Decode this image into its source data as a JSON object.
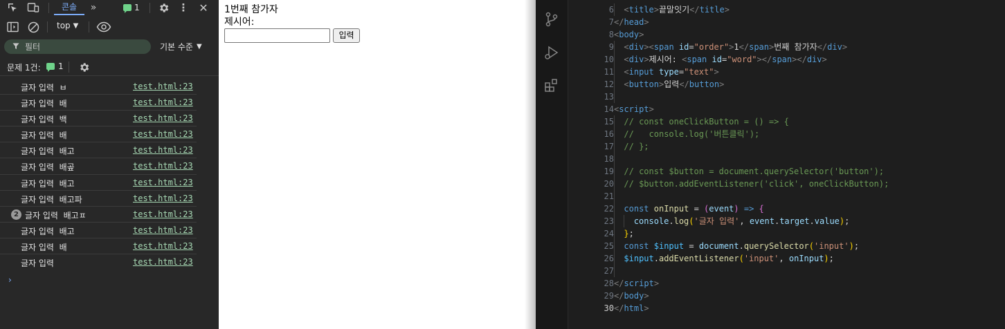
{
  "devtools": {
    "tab_console": "콘솔",
    "message_count": "1",
    "context": "top",
    "filter_placeholder": "필터",
    "levels": "기본 수준",
    "issues_label": "문제 1건:",
    "issues_count": "1",
    "logs": [
      {
        "text": "글자 입력  ㅂ",
        "source": "test.html:23"
      },
      {
        "text": "글자 입력  배",
        "source": "test.html:23"
      },
      {
        "text": "글자 입력  백",
        "source": "test.html:23"
      },
      {
        "text": "글자 입력  배",
        "source": "test.html:23"
      },
      {
        "text": "글자 입력  배고",
        "source": "test.html:23"
      },
      {
        "text": "글자 입력  배곺",
        "source": "test.html:23"
      },
      {
        "text": "글자 입력  배고",
        "source": "test.html:23"
      },
      {
        "text": "글자 입력  배고파",
        "source": "test.html:23"
      },
      {
        "text": "글자 입력  배고ㅍ",
        "source": "test.html:23",
        "count": "2"
      },
      {
        "text": "글자 입력  배고",
        "source": "test.html:23"
      },
      {
        "text": "글자 입력  배",
        "source": "test.html:23"
      },
      {
        "text": "글자 입력",
        "source": "test.html:23"
      }
    ],
    "prompt": "›"
  },
  "page": {
    "order_number": "1",
    "order_suffix": "번째 참가자",
    "word_label": "제시어:",
    "input_value": "",
    "button_label": "입력"
  },
  "editor": {
    "active_line": 30,
    "lines": [
      {
        "n": "6",
        "indent": 1,
        "html": "<span class=\"t\">&lt;</span><span class=\"tn\">title</span><span class=\"t\">&gt;</span><span class=\"tx\">끝말잇기</span><span class=\"t\">&lt;/</span><span class=\"tn\">title</span><span class=\"t\">&gt;</span>"
      },
      {
        "n": "7",
        "indent": 0,
        "html": "<span class=\"t\">&lt;/</span><span class=\"tn\">head</span><span class=\"t\">&gt;</span>"
      },
      {
        "n": "8",
        "indent": 0,
        "html": "<span class=\"t\">&lt;</span><span class=\"tn\">body</span><span class=\"t\">&gt;</span>"
      },
      {
        "n": "9",
        "indent": 1,
        "html": "<span class=\"t\">&lt;</span><span class=\"tn\">div</span><span class=\"t\">&gt;&lt;</span><span class=\"tn\">span</span> <span class=\"an\">id</span><span class=\"op\">=</span><span class=\"av\">\"order\"</span><span class=\"t\">&gt;</span><span class=\"tx\">1</span><span class=\"t\">&lt;/</span><span class=\"tn\">span</span><span class=\"t\">&gt;</span><span class=\"tx\">번째 참가자</span><span class=\"t\">&lt;/</span><span class=\"tn\">div</span><span class=\"t\">&gt;</span>"
      },
      {
        "n": "10",
        "indent": 1,
        "html": "<span class=\"t\">&lt;</span><span class=\"tn\">div</span><span class=\"t\">&gt;</span><span class=\"tx\">제시어: </span><span class=\"t\">&lt;</span><span class=\"tn\">span</span> <span class=\"an\">id</span><span class=\"op\">=</span><span class=\"av\">\"word\"</span><span class=\"t\">&gt;&lt;/</span><span class=\"tn\">span</span><span class=\"t\">&gt;&lt;/</span><span class=\"tn\">div</span><span class=\"t\">&gt;</span>"
      },
      {
        "n": "11",
        "indent": 1,
        "html": "<span class=\"t\">&lt;</span><span class=\"tn\">input</span> <span class=\"an\">type</span><span class=\"op\">=</span><span class=\"av\">\"text\"</span><span class=\"t\">&gt;</span>"
      },
      {
        "n": "12",
        "indent": 1,
        "html": "<span class=\"t\">&lt;</span><span class=\"tn\">button</span><span class=\"t\">&gt;</span><span class=\"tx\">입력</span><span class=\"t\">&lt;/</span><span class=\"tn\">button</span><span class=\"t\">&gt;</span>"
      },
      {
        "n": "13",
        "indent": 1,
        "html": ""
      },
      {
        "n": "14",
        "indent": 0,
        "html": "<span class=\"t\">&lt;</span><span class=\"tn\">script</span><span class=\"t\">&gt;</span>"
      },
      {
        "n": "15",
        "indent": 1,
        "html": "<span class=\"cm\">// const oneClickButton = () =&gt; {</span>"
      },
      {
        "n": "16",
        "indent": 1,
        "html": "<span class=\"cm\">//   console.log('버튼클릭');</span>"
      },
      {
        "n": "17",
        "indent": 1,
        "html": "<span class=\"cm\">// };</span>"
      },
      {
        "n": "18",
        "indent": 1,
        "html": ""
      },
      {
        "n": "19",
        "indent": 1,
        "html": "<span class=\"cm\">// const $button = document.querySelector('button');</span>"
      },
      {
        "n": "20",
        "indent": 1,
        "html": "<span class=\"cm\">// $button.addEventListener('click', oneClickButton);</span>"
      },
      {
        "n": "21",
        "indent": 1,
        "html": ""
      },
      {
        "n": "22",
        "indent": 1,
        "html": "<span class=\"kw\">const</span> <span class=\"fn\">onInput</span> <span class=\"op\">=</span> <span class=\"b2\">(</span><span class=\"pr\">event</span><span class=\"b2\">)</span> <span class=\"kw\">=&gt;</span> <span class=\"b2\">{</span>"
      },
      {
        "n": "23",
        "indent": 2,
        "html": "<span class=\"pr\">console</span><span class=\"op\">.</span><span class=\"fn\">log</span><span class=\"b1\">(</span><span class=\"av\">'글자 입력'</span><span class=\"op\">, </span><span class=\"pr\">event</span><span class=\"op\">.</span><span class=\"pr\">target</span><span class=\"op\">.</span><span class=\"pr\">value</span><span class=\"b1\">)</span><span class=\"op\">;</span>"
      },
      {
        "n": "24",
        "indent": 1,
        "html": "<span class=\"b1\">}</span><span class=\"op\">;</span>"
      },
      {
        "n": "25",
        "indent": 1,
        "html": "<span class=\"kw\">const</span> <span class=\"id\">$input</span> <span class=\"op\">=</span> <span class=\"pr\">document</span><span class=\"op\">.</span><span class=\"fn\">querySelector</span><span class=\"b1\">(</span><span class=\"av\">'input'</span><span class=\"b1\">)</span><span class=\"op\">;</span>"
      },
      {
        "n": "26",
        "indent": 1,
        "html": "<span class=\"id\">$input</span><span class=\"op\">.</span><span class=\"fn\">addEventListener</span><span class=\"b1\">(</span><span class=\"av\">'input'</span><span class=\"op\">, </span><span class=\"pr\">onInput</span><span class=\"b1\">)</span><span class=\"op\">;</span>"
      },
      {
        "n": "27",
        "indent": 1,
        "html": ""
      },
      {
        "n": "28",
        "indent": 0,
        "html": "<span class=\"t\">&lt;/</span><span class=\"tn\">script</span><span class=\"t\">&gt;</span>"
      },
      {
        "n": "29",
        "indent": 0,
        "html": "<span class=\"t\">&lt;/</span><span class=\"tn\">body</span><span class=\"t\">&gt;</span>"
      },
      {
        "n": "30",
        "indent": 0,
        "html": "<span class=\"t\">&lt;/</span><span class=\"tn\">html</span><span class=\"t\">&gt;</span>"
      }
    ]
  }
}
